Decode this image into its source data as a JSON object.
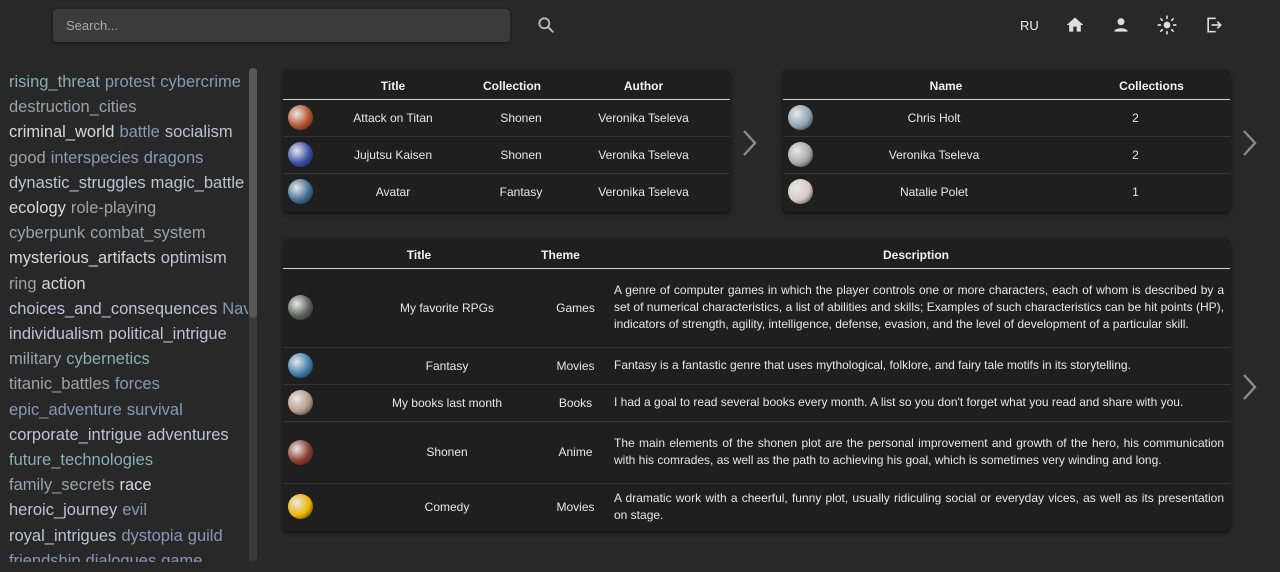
{
  "header": {
    "search_placeholder": "Search...",
    "language": "RU"
  },
  "sidebar": {
    "tag_lines": [
      [
        {
          "t": "rising_threat",
          "c": "c1"
        },
        {
          "t": "protest",
          "c": "c3"
        },
        {
          "t": "cybercrime",
          "c": "c3"
        }
      ],
      [
        {
          "t": "destruction_cities",
          "c": "c4"
        }
      ],
      [
        {
          "t": "criminal_world",
          "c": "c5"
        },
        {
          "t": "battle",
          "c": "c3"
        },
        {
          "t": "socialism",
          "c": "c2"
        }
      ],
      [
        {
          "t": "good",
          "c": "c4"
        },
        {
          "t": "interspecies",
          "c": "c3"
        },
        {
          "t": "dragons",
          "c": "c3"
        }
      ],
      [
        {
          "t": "dynastic_struggles",
          "c": "c2"
        },
        {
          "t": "magic_battle",
          "c": "c2"
        }
      ],
      [
        {
          "t": "ecology",
          "c": "c5"
        },
        {
          "t": "role-playing",
          "c": "c4"
        }
      ],
      [
        {
          "t": "cyberpunk",
          "c": "c4"
        },
        {
          "t": "combat_system",
          "c": "c4"
        }
      ],
      [
        {
          "t": "mysterious_artifacts",
          "c": "c5"
        },
        {
          "t": "optimism",
          "c": "c2"
        }
      ],
      [
        {
          "t": "ring",
          "c": "c4"
        },
        {
          "t": "action",
          "c": "c5"
        }
      ],
      [
        {
          "t": "choices_and_consequences",
          "c": "c2"
        },
        {
          "t": "Navi",
          "c": "c3"
        }
      ],
      [
        {
          "t": "individualism",
          "c": "c2"
        },
        {
          "t": "political_intrigue",
          "c": "c2"
        }
      ],
      [
        {
          "t": "military",
          "c": "c4"
        },
        {
          "t": "cybernetics",
          "c": "c1"
        }
      ],
      [
        {
          "t": "titanic_battles",
          "c": "c4"
        },
        {
          "t": "forces",
          "c": "c3"
        }
      ],
      [
        {
          "t": "epic_adventure",
          "c": "c3"
        },
        {
          "t": "survival",
          "c": "c3"
        }
      ],
      [
        {
          "t": "corporate_intrigue",
          "c": "c2"
        },
        {
          "t": "adventures",
          "c": "c2"
        }
      ],
      [
        {
          "t": "future_technologies",
          "c": "c1"
        }
      ],
      [
        {
          "t": "family_secrets",
          "c": "c4"
        },
        {
          "t": "race",
          "c": "c5"
        }
      ],
      [
        {
          "t": "heroic_journey",
          "c": "c2"
        },
        {
          "t": "evil",
          "c": "c3"
        }
      ],
      [
        {
          "t": "royal_intrigues",
          "c": "c2"
        },
        {
          "t": "dystopia",
          "c": "c3"
        },
        {
          "t": "guild",
          "c": "c3"
        }
      ],
      [
        {
          "t": "friendship",
          "c": "c3"
        },
        {
          "t": "dialogues",
          "c": "c3"
        },
        {
          "t": "game",
          "c": "c3"
        }
      ]
    ]
  },
  "items_table": {
    "headers": {
      "title": "Title",
      "collection": "Collection",
      "author": "Author"
    },
    "rows": [
      {
        "title": "Attack on Titan",
        "collection": "Shonen",
        "author": "Veronika Tseleva",
        "avatar_color": "#b5522a"
      },
      {
        "title": "Jujutsu Kaisen",
        "collection": "Shonen",
        "author": "Veronika Tseleva",
        "avatar_color": "#3a4fa8"
      },
      {
        "title": "Avatar",
        "collection": "Fantasy",
        "author": "Veronika Tseleva",
        "avatar_color": "#3f6f94"
      }
    ]
  },
  "users_table": {
    "headers": {
      "name": "Name",
      "collections": "Collections"
    },
    "rows": [
      {
        "name": "Chris Holt",
        "collections": "2",
        "avatar_color": "#8ea3b3"
      },
      {
        "name": "Veronika Tseleva",
        "collections": "2",
        "avatar_color": "#a8a8a8"
      },
      {
        "name": "Natalie Polet",
        "collections": "1",
        "avatar_color": "#d9c9c2"
      }
    ]
  },
  "collections_table": {
    "headers": {
      "title": "Title",
      "theme": "Theme",
      "description": "Description"
    },
    "rows": [
      {
        "title": "My favorite RPGs",
        "theme": "Games",
        "description": "A genre of computer games in which the player controls one or more characters, each of whom is described by a set of numerical characteristics, a list of abilities and skills; Examples of such characteristics can be hit points (HP), indicators of strength, agility, intelligence, defense, evasion, and the level of development of a particular skill.",
        "avatar_color": "#5b6159"
      },
      {
        "title": "Fantasy",
        "theme": "Movies",
        "description": "Fantasy is a fantastic genre that uses mythological, folklore, and fairy tale motifs in its storytelling.",
        "avatar_color": "#3c7fa8"
      },
      {
        "title": "My books last month",
        "theme": "Books",
        "description": "I had a goal to read several books every month. A list so you don't forget what you read and share with you.",
        "avatar_color": "#b49a85"
      },
      {
        "title": "Shonen",
        "theme": "Anime",
        "description": "The main elements of the shonen plot are the personal improvement and growth of the hero, his communication with his comrades, as well as the path to achieving his goal, which is sometimes very winding and long.",
        "avatar_color": "#8c3a2e"
      },
      {
        "title": "Comedy",
        "theme": "Movies",
        "description": "A dramatic work with a cheerful, funny plot, usually ridiculing social or everyday vices, as well as its presentation on stage.",
        "avatar_color": "#f0b400"
      }
    ]
  }
}
